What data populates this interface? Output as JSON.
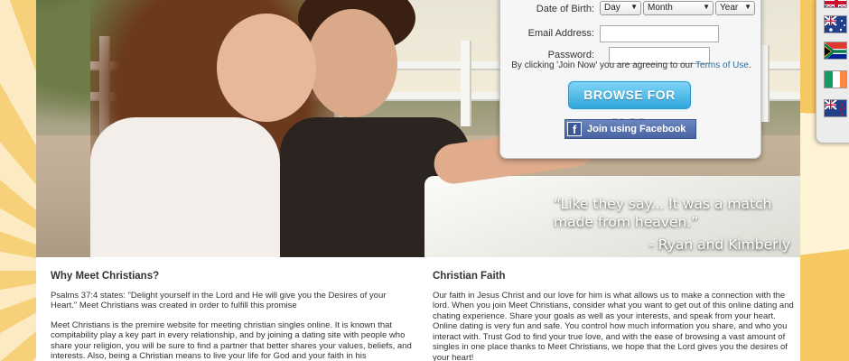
{
  "form": {
    "dob_label": "Date of Birth:",
    "day": "Day",
    "month": "Month",
    "year": "Year",
    "email_label": "Email Address:",
    "password_label": "Password:",
    "terms_prefix": "By clicking 'Join Now' you are agreeing to our",
    "terms_link": "Terms of Use",
    "terms_suffix": ".",
    "browse_label": "BROWSE FOR FREE!",
    "facebook_label": "Join using Facebook",
    "facebook_icon": "f"
  },
  "testimonial": {
    "quote": "“Like they say... It was a match made from heaven.”",
    "author": "- Ryan and Kimberly"
  },
  "flags": [
    "flag-united-kingdom-icon",
    "flag-australia-icon",
    "flag-south-africa-icon",
    "flag-ireland-icon",
    "flag-new-zealand-icon"
  ],
  "left": {
    "title": "Why Meet Christians?",
    "p1": "Psalms 37:4 states: \"Delight yourself in the Lord and He will give you the Desires of your Heart.\" Meet Christians was created in order to fulfill this promise",
    "p2": "Meet Christians is the premire website for meeting christian singles online. It is known that compitability play a key part in every relationship, and by joining a dating site with people who share your religion, you will be sure to find a partner that better shares your values, beliefs, and interests. Also, being a Christian means to live your life for God and your faith in his"
  },
  "right": {
    "title": "Christian Faith",
    "p1": "Our faith in Jesus Christ and our love for him is what allows us to make a connection with the lord. When you join Meet Christians, consider what you want to get out of this online dating and chating experience. Share your goals as well as your interests, and speak from your heart. Online dating is very fun and safe. You control how much information you share, and who you interact with. Trust God to find your true love, and with the ease of browsing a vast amount of singles in one place thanks to Meet Christians, we hope that the Lord gives you the desires of your heart!"
  }
}
